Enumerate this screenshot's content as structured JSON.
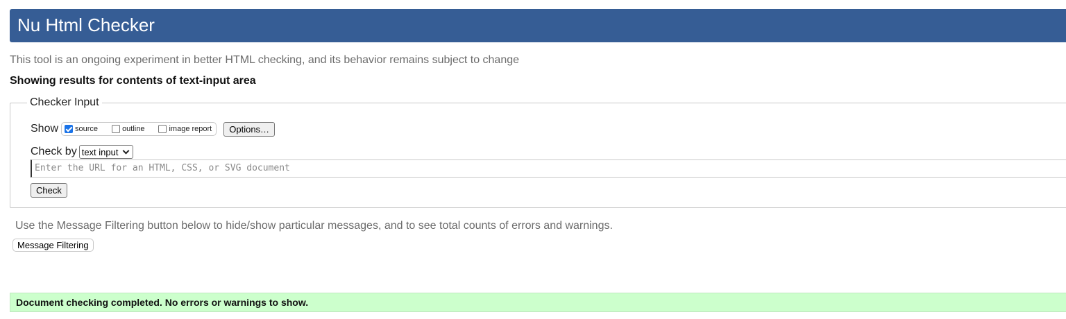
{
  "header": {
    "title": "Nu Html Checker"
  },
  "tagline": "This tool is an ongoing experiment in better HTML checking, and its behavior remains subject to change",
  "results_heading": "Showing results for contents of text-input area",
  "checker_input": {
    "legend": "Checker Input",
    "show_label": "Show",
    "show_options": [
      {
        "label": "source",
        "checked": true
      },
      {
        "label": "outline",
        "checked": false
      },
      {
        "label": "image report",
        "checked": false
      }
    ],
    "options_button": "Options…",
    "check_by_label": "Check by",
    "check_by_value": "text input",
    "url_placeholder": "Enter the URL for an HTML, CSS, or SVG document",
    "check_button": "Check"
  },
  "message_filtering": {
    "note": "Use the Message Filtering button below to hide/show particular messages, and to see total counts of errors and warnings.",
    "button": "Message Filtering"
  },
  "result": {
    "text": "Document checking completed. No errors or warnings to show.",
    "color": "#ccffcc"
  },
  "colors": {
    "header_bg": "#365d95",
    "checkbox_accent": "#1a73e8"
  }
}
